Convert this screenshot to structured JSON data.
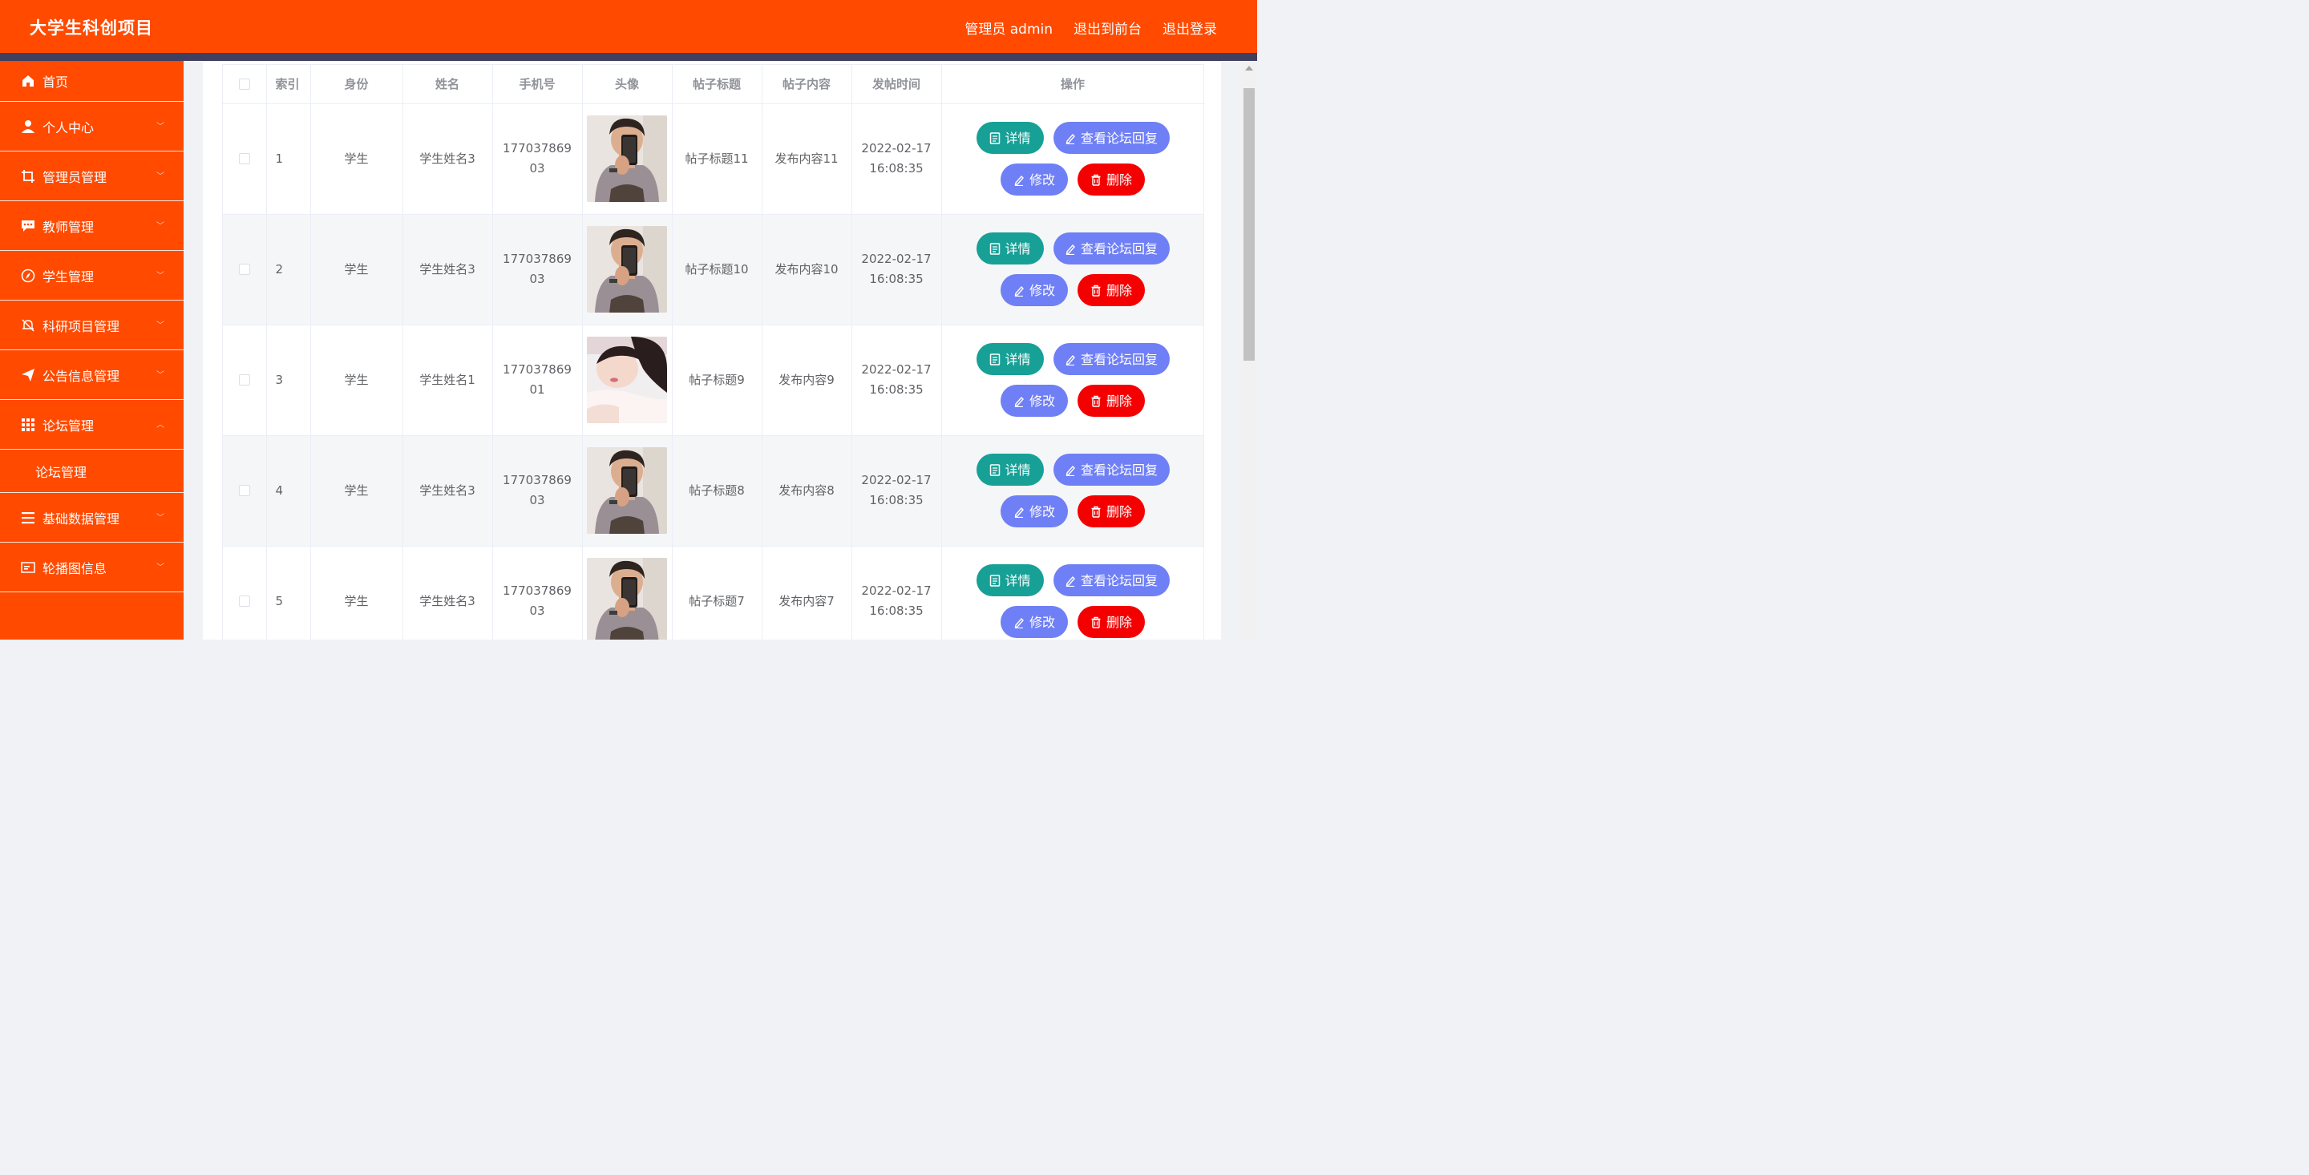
{
  "header": {
    "title": "大学生科创项目",
    "admin_label": "管理员 admin",
    "to_front": "退出到前台",
    "logout": "退出登录"
  },
  "sidebar": {
    "items": [
      {
        "label": "首页",
        "icon": "home-icon"
      },
      {
        "label": "个人中心",
        "icon": "user-icon"
      },
      {
        "label": "管理员管理",
        "icon": "crop-icon"
      },
      {
        "label": "教师管理",
        "icon": "chat-icon"
      },
      {
        "label": "学生管理",
        "icon": "compass-icon"
      },
      {
        "label": "科研项目管理",
        "icon": "bell-off-icon"
      },
      {
        "label": "公告信息管理",
        "icon": "send-icon"
      },
      {
        "label": "论坛管理",
        "icon": "grid-icon"
      },
      {
        "label": "基础数据管理",
        "icon": "list-icon"
      },
      {
        "label": "轮播图信息",
        "icon": "banner-icon"
      }
    ],
    "sub_forum": "论坛管理"
  },
  "table": {
    "headers": [
      "索引",
      "身份",
      "姓名",
      "手机号",
      "头像",
      "帖子标题",
      "帖子内容",
      "发帖时间",
      "操作"
    ],
    "rows": [
      {
        "idx": "1",
        "role": "学生",
        "name": "学生姓名3",
        "phone1": "177037869",
        "phone2": "03",
        "title": "帖子标题11",
        "content": "发布内容11",
        "date": "2022-02-17",
        "time": "16:08:35",
        "avatar": "male"
      },
      {
        "idx": "2",
        "role": "学生",
        "name": "学生姓名3",
        "phone1": "177037869",
        "phone2": "03",
        "title": "帖子标题10",
        "content": "发布内容10",
        "date": "2022-02-17",
        "time": "16:08:35",
        "avatar": "male"
      },
      {
        "idx": "3",
        "role": "学生",
        "name": "学生姓名1",
        "phone1": "177037869",
        "phone2": "01",
        "title": "帖子标题9",
        "content": "发布内容9",
        "date": "2022-02-17",
        "time": "16:08:35",
        "avatar": "female"
      },
      {
        "idx": "4",
        "role": "学生",
        "name": "学生姓名3",
        "phone1": "177037869",
        "phone2": "03",
        "title": "帖子标题8",
        "content": "发布内容8",
        "date": "2022-02-17",
        "time": "16:08:35",
        "avatar": "male"
      },
      {
        "idx": "5",
        "role": "学生",
        "name": "学生姓名3",
        "phone1": "177037869",
        "phone2": "03",
        "title": "帖子标题7",
        "content": "发布内容7",
        "date": "2022-02-17",
        "time": "16:08:35",
        "avatar": "male"
      }
    ]
  },
  "actions": {
    "detail": "详情",
    "reply": "查看论坛回复",
    "edit": "修改",
    "delete": "删除"
  },
  "colors": {
    "brand": "#ff4a00",
    "detail": "#17a096",
    "primary": "#6f7ff5",
    "danger": "#f50000"
  }
}
